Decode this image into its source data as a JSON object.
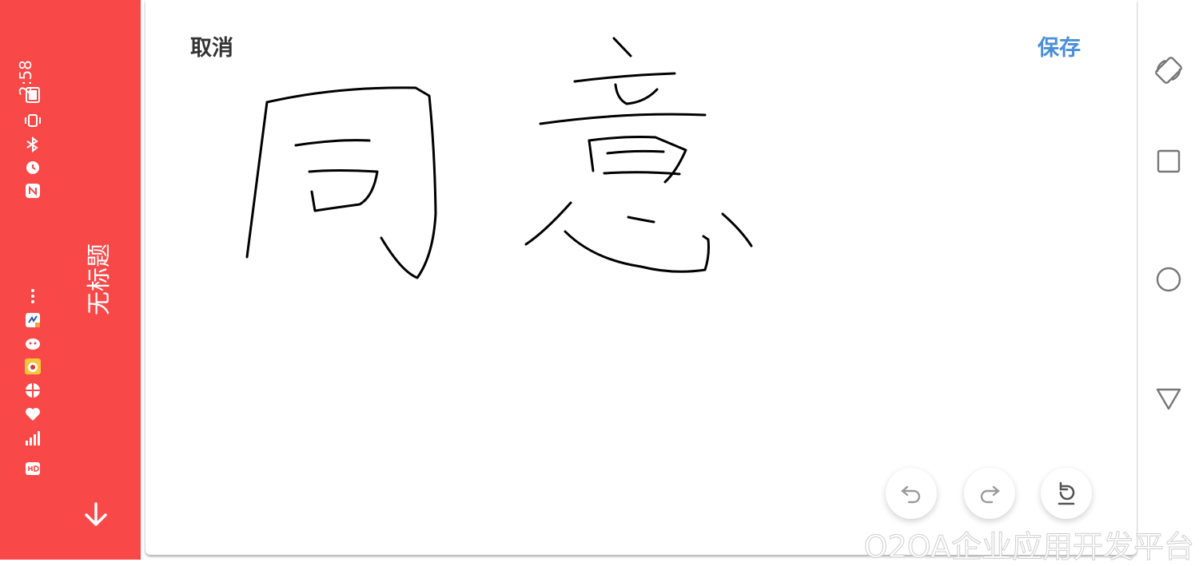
{
  "status_bar": {
    "time": "2:58",
    "icons": [
      "battery-icon",
      "vibrate-icon",
      "bluetooth-icon",
      "alarm-icon",
      "nfc-icon",
      "more-dots-icon",
      "app-notification-icon",
      "chat-notification-icon",
      "weibo-notification-icon",
      "browser-notification-icon",
      "health-notification-icon",
      "signal-icon",
      "hd-icon"
    ]
  },
  "app_bar": {
    "title": "无标题",
    "back_icon": "arrow-down-icon"
  },
  "toolbar": {
    "cancel_label": "取消",
    "save_label": "保存"
  },
  "drawing_tools": [
    "undo-icon",
    "redo-icon",
    "reset-icon"
  ],
  "nav_bar": [
    "rotate-icon",
    "recents-icon",
    "home-icon",
    "back-icon"
  ],
  "watermark": "O2OA企业应用开发平台",
  "colors": {
    "app_bar": "#f84848",
    "save": "#4a8fd8",
    "ink": "#000000"
  }
}
